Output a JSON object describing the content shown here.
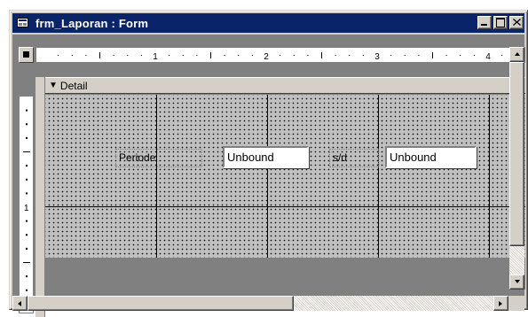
{
  "window": {
    "title": "frm_Laporan : Form"
  },
  "ruler": {
    "horizontal_numbers": [
      "1",
      "2",
      "3",
      "4"
    ],
    "vertical_numbers": [
      "1"
    ]
  },
  "section": {
    "detail_label": "Detail"
  },
  "controls": {
    "label_periode": "Periode",
    "textbox_start": "Unbound",
    "label_sd": "s/d",
    "textbox_end": "Unbound"
  },
  "icons": {
    "window_icon": "form-icon",
    "detail_arrow": "arrow-down-icon",
    "minimize": "minimize-icon",
    "maximize": "maximize-icon",
    "close": "close-icon"
  },
  "colors": {
    "titlebar": "#0a246a",
    "chrome": "#d4d0c8",
    "grid": "#c0c0c0",
    "workspace": "#808080"
  }
}
